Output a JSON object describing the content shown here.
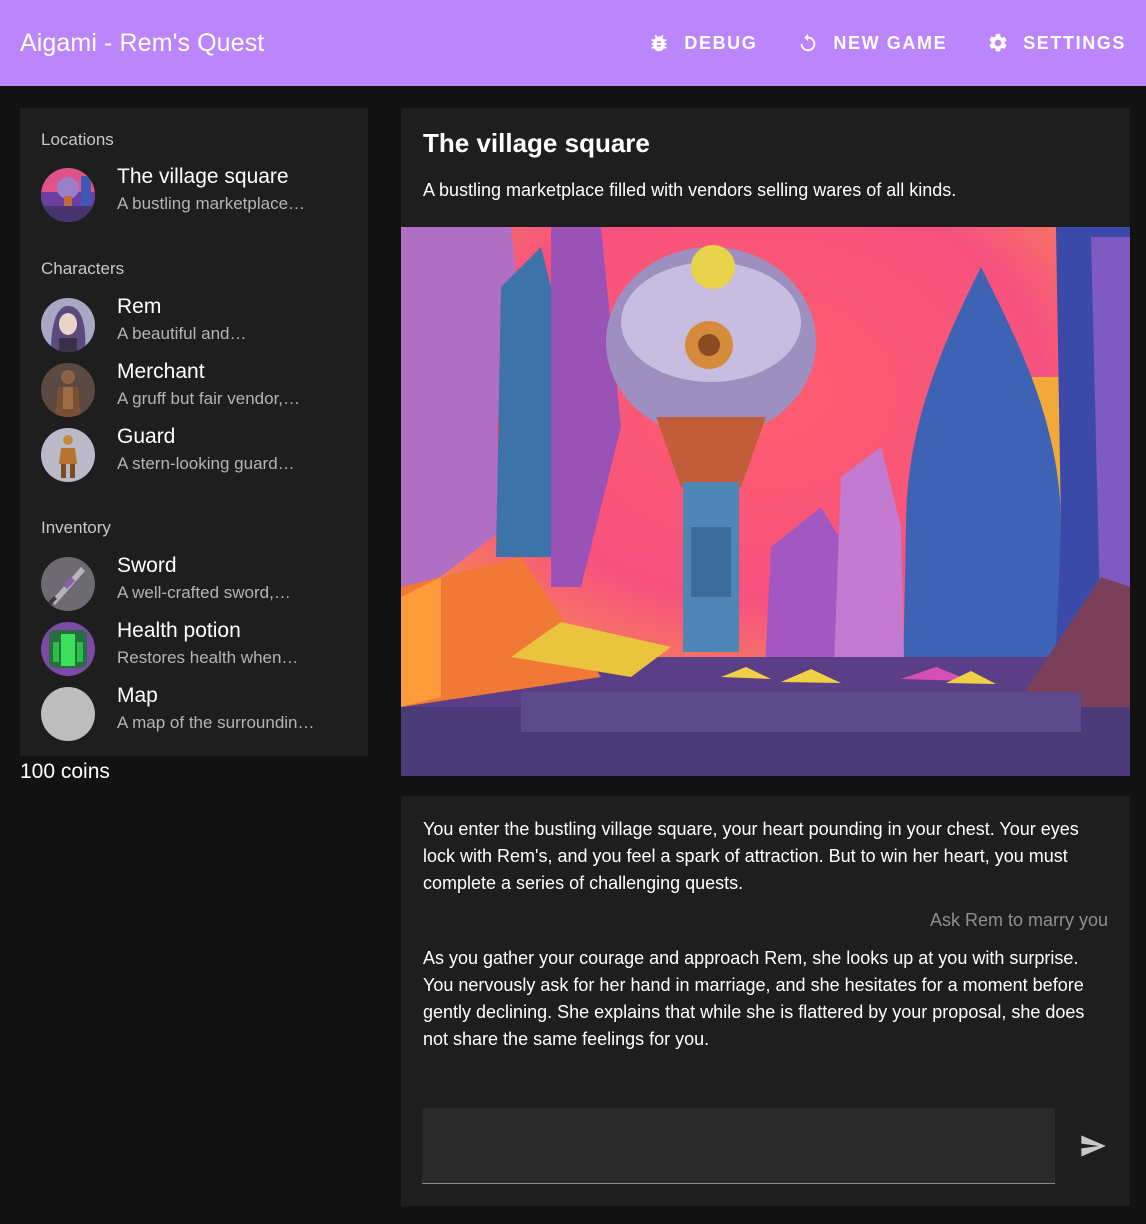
{
  "app": {
    "title": "Aigami - Rem's Quest",
    "brand_color": "#bb86fc"
  },
  "toolbar": {
    "debug_label": "DEBUG",
    "debug_icon": "bug-icon",
    "new_game_label": "NEW GAME",
    "new_game_icon": "restart-icon",
    "settings_label": "SETTINGS",
    "settings_icon": "gear-icon"
  },
  "sidebar": {
    "locations_title": "Locations",
    "locations": [
      {
        "title": "The village square",
        "subtitle": "A bustling marketplace…"
      }
    ],
    "characters_title": "Characters",
    "characters": [
      {
        "title": "Rem",
        "subtitle": "A beautiful and…"
      },
      {
        "title": "Merchant",
        "subtitle": "A gruff but fair vendor,…"
      },
      {
        "title": "Guard",
        "subtitle": "A stern-looking guard…"
      }
    ],
    "inventory_title": "Inventory",
    "inventory": [
      {
        "title": "Sword",
        "subtitle": "A well-crafted sword,…"
      },
      {
        "title": "Health potion",
        "subtitle": "Restores health when…"
      },
      {
        "title": "Map",
        "subtitle": "A map of the surroundin…"
      }
    ],
    "coins": "100 coins"
  },
  "location": {
    "title": "The village square",
    "description": "A bustling marketplace filled with vendors selling wares of all kinds."
  },
  "story": {
    "intro": "You enter the bustling village square, your heart pounding in your chest. Your eyes lock with Rem's, and you feel a spark of attraction. But to win her heart, you must complete a series of challenging quests.",
    "player_action": "Ask Rem to marry you",
    "response": "As you gather your courage and approach Rem, she looks up at you with surprise. You nervously ask for her hand in marriage, and she hesitates for a moment before gently declining. She explains that while she is flattered by your proposal, she does not share the same feelings for you.",
    "input_value": "",
    "send_icon": "send-icon"
  }
}
